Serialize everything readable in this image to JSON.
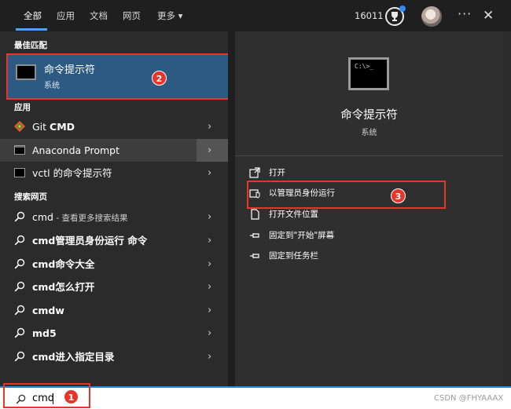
{
  "topbar": {
    "tabs": [
      "全部",
      "应用",
      "文档",
      "网页",
      "更多"
    ],
    "more_arrow": "▾",
    "points": "16011",
    "more_dots": "···",
    "close": "✕"
  },
  "best_match": {
    "section_title": "最佳匹配",
    "title": "命令提示符",
    "subtitle": "系统",
    "badge": "2"
  },
  "apps": {
    "section_title": "应用",
    "items": [
      {
        "prefix": "Git ",
        "bold": "CMD",
        "icon": "git-icon"
      },
      {
        "prefix": "Anaconda Prompt",
        "bold": "",
        "icon": "terminal-icon"
      },
      {
        "prefix": "vctl 的命令提示符",
        "bold": "",
        "icon": "terminal-icon"
      }
    ]
  },
  "web": {
    "section_title": "搜索网页",
    "items": [
      {
        "bold": "cmd",
        "rest": " - 查看更多搜索结果"
      },
      {
        "bold": "cmd管理员身份运行 命令",
        "rest": ""
      },
      {
        "bold": "cmd命令大全",
        "rest": ""
      },
      {
        "bold": "cmd怎么打开",
        "rest": ""
      },
      {
        "bold": "cmdw",
        "rest": ""
      },
      {
        "bold": "md5",
        "rest": ""
      },
      {
        "bold": "cmd进入指定目录",
        "rest": ""
      }
    ]
  },
  "detail": {
    "icon_text": "C:\\>_",
    "title": "命令提示符",
    "subtitle": "系统",
    "actions": [
      {
        "label": "打开",
        "icon": "open-icon"
      },
      {
        "label": "以管理员身份运行",
        "icon": "admin-shield-icon"
      },
      {
        "label": "打开文件位置",
        "icon": "file-location-icon"
      },
      {
        "label": "固定到\"开始\"屏幕",
        "icon": "pin-icon"
      },
      {
        "label": "固定到任务栏",
        "icon": "pin-icon"
      }
    ],
    "badge": "3"
  },
  "search": {
    "value": "cmd",
    "badge": "1",
    "watermark": "CSDN @FHYAAAX"
  },
  "colors": {
    "accent": "#4aa3ff",
    "highlight_box": "#e8352a",
    "selected_bg": "#2d5a82"
  }
}
